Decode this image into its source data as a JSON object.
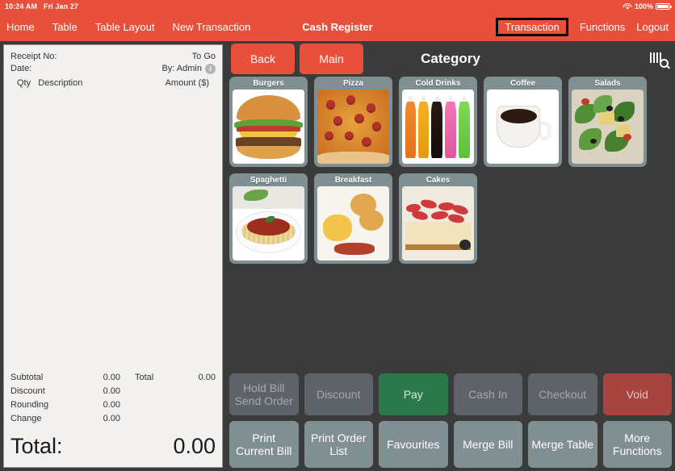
{
  "statusbar": {
    "time": "10:24 AM",
    "date": "Fri Jan 27",
    "battery_percent": "100%",
    "wifi_icon": "wifi-icon",
    "battery_icon": "battery-full-icon"
  },
  "nav": {
    "title": "Cash Register",
    "left_items": [
      {
        "label": "Home"
      },
      {
        "label": "Table"
      },
      {
        "label": "Table Layout"
      },
      {
        "label": "New Transaction"
      }
    ],
    "right_items": [
      {
        "label": "Transaction",
        "selected": true
      },
      {
        "label": "Functions",
        "selected": false
      },
      {
        "label": "Logout",
        "selected": false
      }
    ]
  },
  "receipt": {
    "receipt_no_label": "Receipt No:",
    "receipt_no_value": "",
    "order_type": "To Go",
    "date_label": "Date:",
    "date_value": "",
    "operator": "By: Admin",
    "info_icon": "info-icon",
    "col_qty": "Qty",
    "col_description": "Description",
    "col_amount": "Amount ($)",
    "items": [],
    "totals": [
      {
        "label": "Subtotal",
        "value": "0.00"
      },
      {
        "label": "Discount",
        "value": "0.00"
      },
      {
        "label": "Rounding",
        "value": "0.00"
      },
      {
        "label": "Change",
        "value": "0.00"
      }
    ],
    "side_total_label": "Total",
    "side_total_value": "0.00",
    "grand_total_label": "Total:",
    "grand_total_value": "0.00"
  },
  "toolbar": {
    "back_label": "Back",
    "main_label": "Main",
    "title": "Category",
    "scan_icon": "barcode-search-icon"
  },
  "categories": [
    {
      "label": "Burgers",
      "art": "burger"
    },
    {
      "label": "Pizza",
      "art": "pizza"
    },
    {
      "label": "Cold Drinks",
      "art": "drinks"
    },
    {
      "label": "Coffee",
      "art": "coffee"
    },
    {
      "label": "Salads",
      "art": "salad"
    },
    {
      "label": "Spaghetti",
      "art": "spaghetti"
    },
    {
      "label": "Breakfast",
      "art": "breakfast"
    },
    {
      "label": "Cakes",
      "art": "cake"
    }
  ],
  "actions": {
    "row1": [
      {
        "label": "Hold Bill\nSend Order",
        "style": "dim"
      },
      {
        "label": "Discount",
        "style": "dim"
      },
      {
        "label": "Pay",
        "style": "pay"
      },
      {
        "label": "Cash In",
        "style": "dim"
      },
      {
        "label": "Checkout",
        "style": "dim"
      },
      {
        "label": "Void",
        "style": "void"
      }
    ],
    "row2": [
      {
        "label": "Print\nCurrent Bill",
        "style": "slate"
      },
      {
        "label": "Print Order\nList",
        "style": "slate"
      },
      {
        "label": "Favourites",
        "style": "slate"
      },
      {
        "label": "Merge Bill",
        "style": "slate"
      },
      {
        "label": "Merge Table",
        "style": "slate"
      },
      {
        "label": "More\nFunctions",
        "style": "slate"
      }
    ]
  },
  "colors": {
    "brand_red": "#e8503c",
    "background": "#3b3b3b",
    "slate": "#7f8f92",
    "dim": "#5d6368",
    "pay_green": "#2c7a4b",
    "void_red": "#a64540",
    "receipt_bg": "#f2f1ef"
  }
}
